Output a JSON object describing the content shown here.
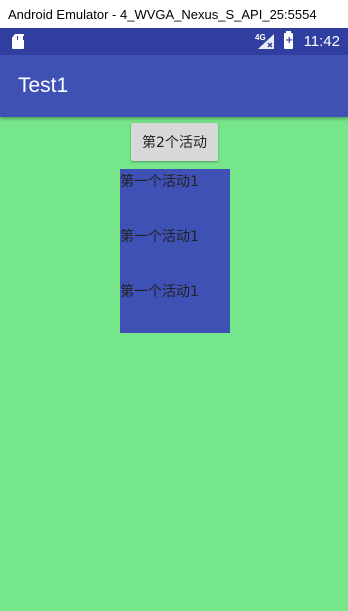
{
  "window": {
    "title": "Android Emulator - 4_WVGA_Nexus_S_API_25:5554"
  },
  "status_bar": {
    "network": "4G",
    "time": "11:42",
    "icons": [
      "sd-card-icon",
      "signal-icon",
      "battery-icon"
    ]
  },
  "app_bar": {
    "title": "Test1"
  },
  "main": {
    "button_label": "第2个活动",
    "texts": [
      "第一个活动1",
      "第一个活动1",
      "第一个活动1"
    ]
  },
  "colors": {
    "status_bar": "#303f9f",
    "app_bar": "#3f51b5",
    "content_bg": "#76e68a",
    "blue_box": "#3f51b5",
    "button_bg": "#d8d8d8"
  }
}
